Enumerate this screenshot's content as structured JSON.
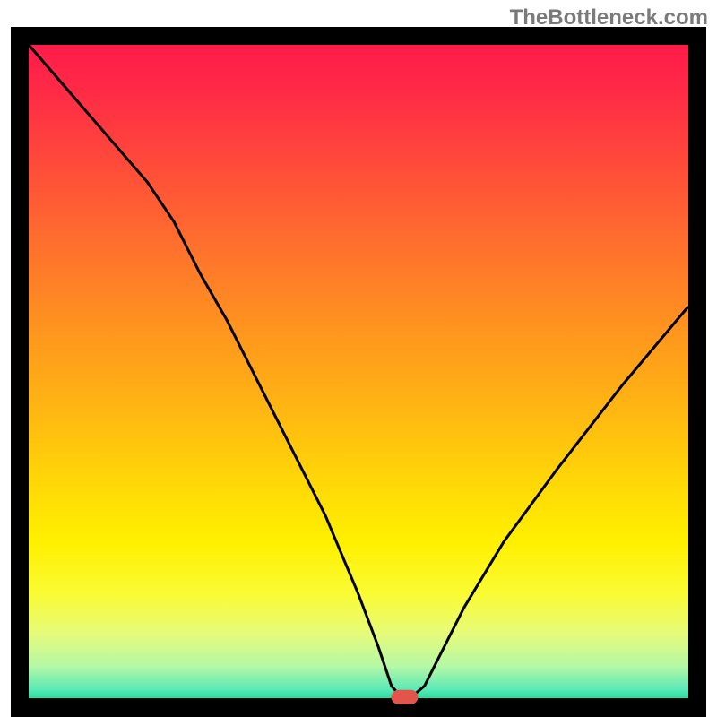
{
  "watermark": "TheBottleneck.com",
  "chart_data": {
    "type": "line",
    "title": "",
    "xlabel": "",
    "ylabel": "",
    "xlim": [
      0,
      100
    ],
    "ylim": [
      0,
      100
    ],
    "x": [
      0,
      6,
      12,
      18,
      22,
      26,
      30,
      35,
      40,
      45,
      50,
      53,
      55,
      56.5,
      58,
      60,
      62,
      66,
      72,
      80,
      90,
      100
    ],
    "values": [
      100,
      93,
      86,
      79,
      73,
      65,
      58,
      48,
      38,
      28,
      16,
      8,
      2,
      0.3,
      0.3,
      2,
      6,
      14,
      24,
      35,
      48,
      60
    ],
    "marker": {
      "x": 57,
      "y": 0.3
    },
    "gradient_stops": [
      {
        "offset": 0.0,
        "color": "#ff1c4a"
      },
      {
        "offset": 0.07,
        "color": "#ff2a46"
      },
      {
        "offset": 0.18,
        "color": "#ff4a3a"
      },
      {
        "offset": 0.3,
        "color": "#ff6e2e"
      },
      {
        "offset": 0.42,
        "color": "#ff9020"
      },
      {
        "offset": 0.55,
        "color": "#ffb413"
      },
      {
        "offset": 0.66,
        "color": "#ffd508"
      },
      {
        "offset": 0.76,
        "color": "#fff000"
      },
      {
        "offset": 0.84,
        "color": "#f9fb34"
      },
      {
        "offset": 0.9,
        "color": "#e6fb7a"
      },
      {
        "offset": 0.95,
        "color": "#b4f8a6"
      },
      {
        "offset": 0.985,
        "color": "#5de9b6"
      },
      {
        "offset": 1.0,
        "color": "#1fdf9c"
      }
    ],
    "border_px": 20,
    "line_color": "#000000",
    "line_width": 3,
    "marker_color": "#e2554d"
  }
}
